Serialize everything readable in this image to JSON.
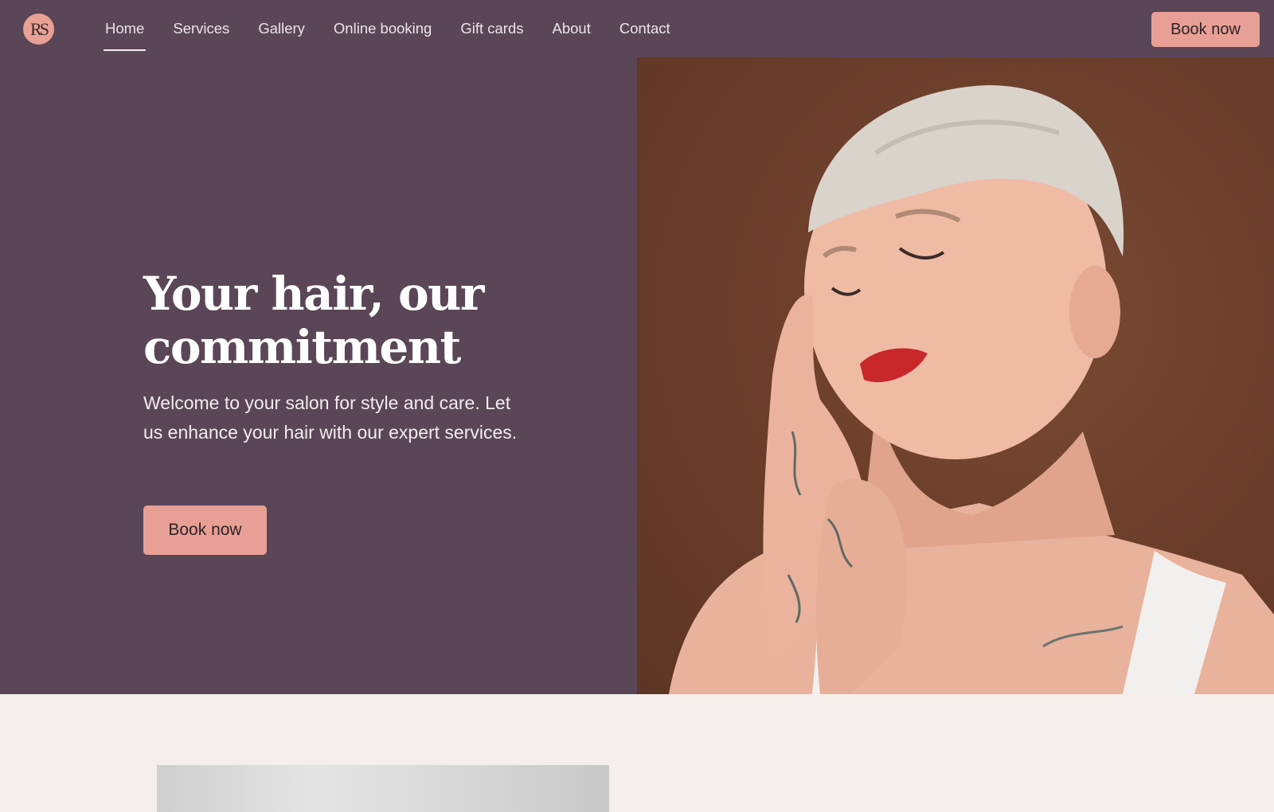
{
  "brand": {
    "logo_text": "RS",
    "accent_color": "#e8a096",
    "primary_color": "#5a4656"
  },
  "nav": {
    "items": [
      {
        "label": "Home",
        "active": true
      },
      {
        "label": "Services"
      },
      {
        "label": "Gallery"
      },
      {
        "label": "Online booking"
      },
      {
        "label": "Gift cards"
      },
      {
        "label": "About"
      },
      {
        "label": "Contact"
      }
    ],
    "book_label": "Book now"
  },
  "hero": {
    "title": "Your hair, our commitment",
    "subtitle": "Welcome to your salon for style and care. Let us enhance your hair with our expert services.",
    "button_label": "Book now"
  }
}
